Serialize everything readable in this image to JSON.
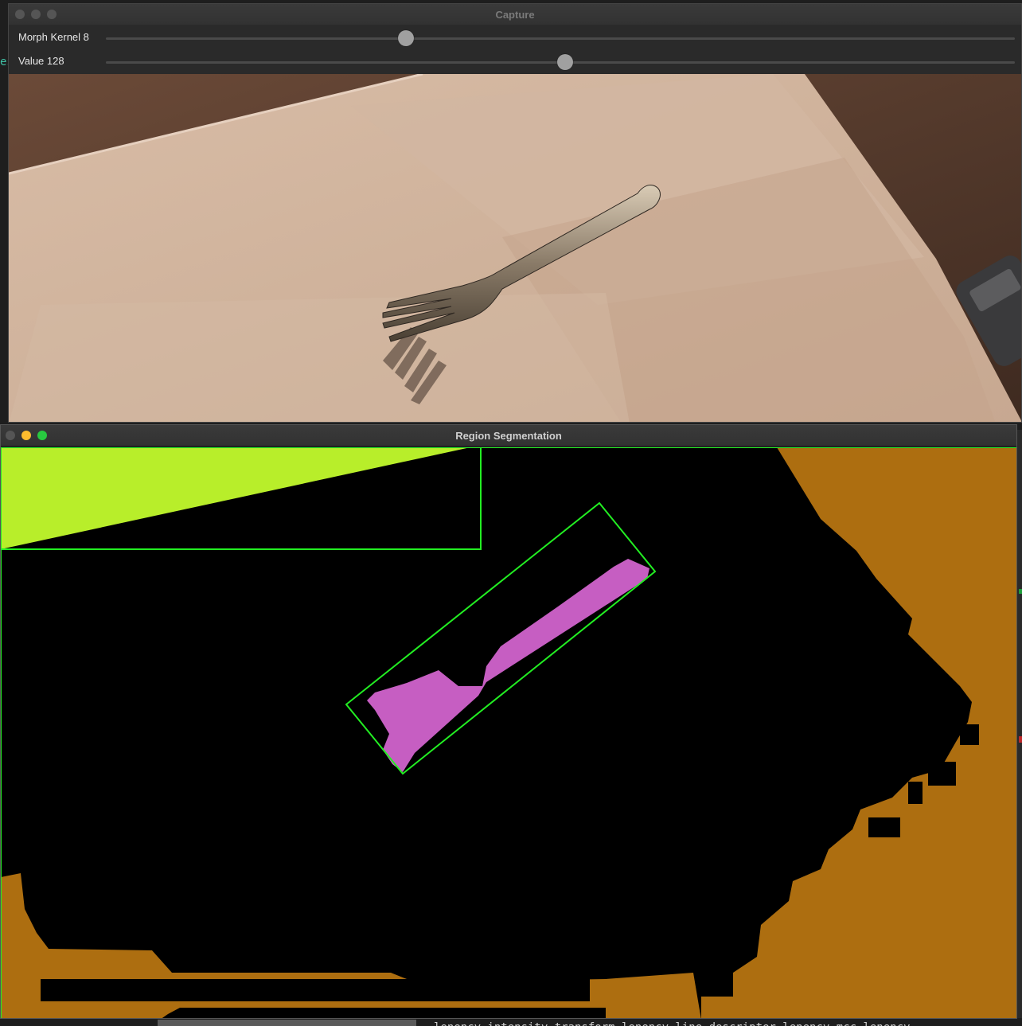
{
  "capture_window": {
    "title": "Capture",
    "sliders": [
      {
        "label": "Morph Kernel 8",
        "value_fraction": 0.33
      },
      {
        "label": "Value 128",
        "value_fraction": 0.505
      }
    ]
  },
  "segmentation_window": {
    "title": "Region Segmentation",
    "region_colors": {
      "yellow_green": "#b8ee2a",
      "brown": "#ad6e10",
      "magenta": "#c65ec2",
      "box": "#22ff22"
    }
  },
  "background": {
    "left_text": "es",
    "bottom_text": "lenency intensity transform  lenency line descripter  lenency mcc  lenency"
  }
}
